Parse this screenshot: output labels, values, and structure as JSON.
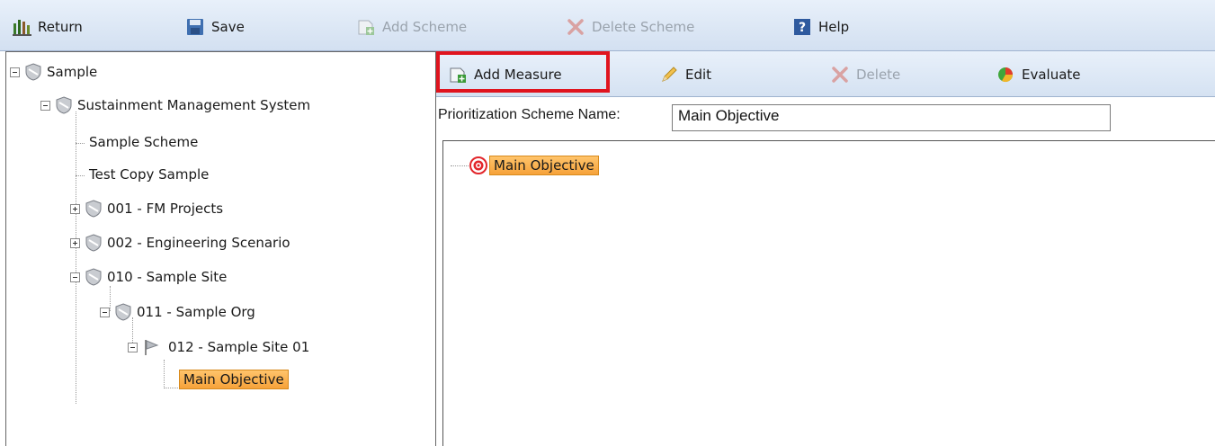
{
  "toolbar": {
    "return_label": "Return",
    "save_label": "Save",
    "add_scheme_label": "Add Scheme",
    "delete_scheme_label": "Delete Scheme",
    "help_label": "Help"
  },
  "tree": {
    "root": "Sample",
    "sms": "Sustainment Management System",
    "sample_scheme": "Sample Scheme",
    "test_copy": "Test Copy Sample",
    "fm_projects": "001 - FM Projects",
    "eng_scenario": "002 - Engineering Scenario",
    "sample_site": "010 - Sample Site",
    "sample_org": "011 - Sample Org",
    "sample_site_01": "012 - Sample Site 01",
    "main_objective": "Main Objective"
  },
  "subtoolbar": {
    "add_measure_label": "Add Measure",
    "edit_label": "Edit",
    "delete_label": "Delete",
    "evaluate_label": "Evaluate"
  },
  "scheme": {
    "name_label": "Prioritization Scheme Name:",
    "name_value": "Main Objective"
  },
  "canvas": {
    "root_node": "Main Objective"
  },
  "colors": {
    "accent_red": "#e0141e",
    "selection_orange": "#f6a23a",
    "toolbar_blue": "#d3e0f1"
  }
}
